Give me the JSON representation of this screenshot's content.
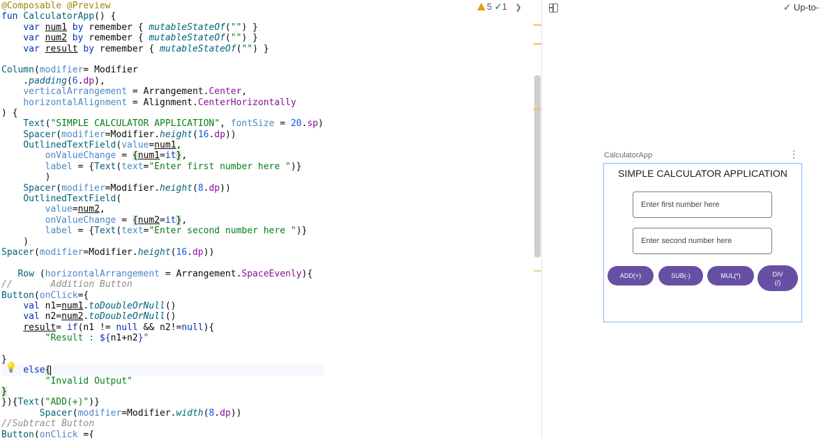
{
  "editor": {
    "inspections": {
      "warnings": "5",
      "weak_warnings": "1"
    },
    "code_lines": [
      [
        [
          "ann",
          "@Composable @Preview"
        ]
      ],
      [
        [
          "kw",
          "fun "
        ],
        [
          "fn",
          "CalculatorApp"
        ],
        [
          "",
          "() {"
        ]
      ],
      [
        [
          "",
          "    "
        ],
        [
          "kw",
          "var "
        ],
        [
          "uv",
          "num1"
        ],
        [
          "kw",
          " by "
        ],
        [
          "",
          "remember { "
        ],
        [
          "ext",
          "mutableStateOf"
        ],
        [
          "",
          "("
        ],
        [
          "str",
          "\"\""
        ],
        [
          "",
          ") }"
        ]
      ],
      [
        [
          "",
          "    "
        ],
        [
          "kw",
          "var "
        ],
        [
          "uv",
          "num2"
        ],
        [
          "kw",
          " by "
        ],
        [
          "",
          "remember { "
        ],
        [
          "ext",
          "mutableStateOf"
        ],
        [
          "",
          "("
        ],
        [
          "str",
          "\"\""
        ],
        [
          "",
          ") }"
        ]
      ],
      [
        [
          "",
          "    "
        ],
        [
          "kw",
          "var "
        ],
        [
          "uv",
          "result"
        ],
        [
          "kw",
          " by "
        ],
        [
          "",
          "remember { "
        ],
        [
          "ext",
          "mutableStateOf"
        ],
        [
          "",
          "("
        ],
        [
          "str",
          "\"\""
        ],
        [
          "",
          ") }"
        ]
      ],
      [],
      [
        [
          "fn",
          "Column"
        ],
        [
          "",
          "("
        ],
        [
          "param",
          "modifier"
        ],
        [
          "",
          "= Modifier"
        ]
      ],
      [
        [
          "",
          "    ."
        ],
        [
          "ext",
          "padding"
        ],
        [
          "",
          "("
        ],
        [
          "num",
          "6"
        ],
        [
          "",
          "."
        ],
        [
          "prop",
          "dp"
        ],
        [
          "",
          "),"
        ]
      ],
      [
        [
          "",
          "    "
        ],
        [
          "param",
          "verticalArrangement"
        ],
        [
          "",
          " = Arrangement."
        ],
        [
          "prop",
          "Center"
        ],
        [
          "",
          ","
        ]
      ],
      [
        [
          "",
          "    "
        ],
        [
          "param",
          "horizontalAlignment"
        ],
        [
          "",
          " = Alignment."
        ],
        [
          "prop",
          "CenterHorizontally"
        ]
      ],
      [
        [
          "",
          ") {"
        ]
      ],
      [
        [
          "",
          "    "
        ],
        [
          "fn",
          "Text"
        ],
        [
          "",
          "("
        ],
        [
          "str",
          "\"SIMPLE CALCULATOR APPLICATION\""
        ],
        [
          "",
          ", "
        ],
        [
          "param",
          "fontSize"
        ],
        [
          "",
          " = "
        ],
        [
          "num",
          "20"
        ],
        [
          "",
          "."
        ],
        [
          "prop",
          "sp"
        ],
        [
          "",
          ")"
        ]
      ],
      [
        [
          "",
          "    "
        ],
        [
          "fn",
          "Spacer"
        ],
        [
          "",
          "("
        ],
        [
          "param",
          "modifier"
        ],
        [
          "",
          "=Modifier."
        ],
        [
          "ext",
          "height"
        ],
        [
          "",
          "("
        ],
        [
          "num",
          "16"
        ],
        [
          "",
          "."
        ],
        [
          "prop",
          "dp"
        ],
        [
          "",
          "))"
        ]
      ],
      [
        [
          "",
          "    "
        ],
        [
          "fn",
          "OutlinedTextField"
        ],
        [
          "",
          "("
        ],
        [
          "param",
          "value"
        ],
        [
          "",
          "="
        ],
        [
          "uv",
          "num1"
        ],
        [
          "",
          ","
        ]
      ],
      [
        [
          "",
          "        "
        ],
        [
          "param",
          "onValueChange"
        ],
        [
          "",
          " = "
        ],
        [
          "hl",
          "{"
        ],
        [
          "uv",
          "num1"
        ],
        [
          "",
          "="
        ],
        [
          "kw",
          "it"
        ],
        [
          "hl",
          "}"
        ],
        [
          "",
          ","
        ]
      ],
      [
        [
          "",
          "        "
        ],
        [
          "param",
          "label"
        ],
        [
          "",
          " = {"
        ],
        [
          "fn",
          "Text"
        ],
        [
          "",
          "("
        ],
        [
          "param",
          "text"
        ],
        [
          "",
          "="
        ],
        [
          "str",
          "\"Enter first number here \""
        ],
        [
          "",
          ")}"
        ]
      ],
      [
        [
          "",
          "        )"
        ]
      ],
      [
        [
          "",
          "    "
        ],
        [
          "fn",
          "Spacer"
        ],
        [
          "",
          "("
        ],
        [
          "param",
          "modifier"
        ],
        [
          "",
          "=Modifier."
        ],
        [
          "ext",
          "height"
        ],
        [
          "",
          "("
        ],
        [
          "num",
          "8"
        ],
        [
          "",
          "."
        ],
        [
          "prop",
          "dp"
        ],
        [
          "",
          "))"
        ]
      ],
      [
        [
          "",
          "    "
        ],
        [
          "fn",
          "OutlinedTextField"
        ],
        [
          "",
          "("
        ]
      ],
      [
        [
          "",
          "        "
        ],
        [
          "param",
          "value"
        ],
        [
          "",
          "="
        ],
        [
          "uv",
          "num2"
        ],
        [
          "",
          ","
        ]
      ],
      [
        [
          "",
          "        "
        ],
        [
          "param",
          "onValueChange"
        ],
        [
          "",
          " = "
        ],
        [
          "hl",
          "{"
        ],
        [
          "uv",
          "num2"
        ],
        [
          "",
          "="
        ],
        [
          "kw",
          "it"
        ],
        [
          "hl",
          "}"
        ],
        [
          "",
          ","
        ]
      ],
      [
        [
          "",
          "        "
        ],
        [
          "param",
          "label"
        ],
        [
          "",
          " = {"
        ],
        [
          "fn",
          "Text"
        ],
        [
          "",
          "("
        ],
        [
          "param",
          "text"
        ],
        [
          "",
          "="
        ],
        [
          "str",
          "\"Enter second number here \""
        ],
        [
          "",
          ")}"
        ]
      ],
      [
        [
          "",
          "    )"
        ]
      ],
      [
        [
          "fn",
          "Spacer"
        ],
        [
          "",
          "("
        ],
        [
          "param",
          "modifier"
        ],
        [
          "",
          "=Modifier."
        ],
        [
          "ext",
          "height"
        ],
        [
          "",
          "("
        ],
        [
          "num",
          "16"
        ],
        [
          "",
          "."
        ],
        [
          "prop",
          "dp"
        ],
        [
          "",
          "))"
        ]
      ],
      [],
      [
        [
          "",
          "   "
        ],
        [
          "fn",
          "Row"
        ],
        [
          "",
          " ("
        ],
        [
          "param",
          "horizontalArrangement"
        ],
        [
          "",
          " = Arrangement."
        ],
        [
          "prop",
          "SpaceEvenly"
        ],
        [
          "",
          "){"
        ]
      ],
      [
        [
          "cmt",
          "//       Addition Button"
        ]
      ],
      [
        [
          "fn",
          "Button"
        ],
        [
          "",
          "("
        ],
        [
          "param",
          "onClick"
        ],
        [
          "",
          "={"
        ]
      ],
      [
        [
          "",
          "    "
        ],
        [
          "kw",
          "val "
        ],
        [
          "",
          "n1="
        ],
        [
          "uv",
          "num1"
        ],
        [
          "",
          "."
        ],
        [
          "ext",
          "toDoubleOrNull"
        ],
        [
          "",
          "()"
        ]
      ],
      [
        [
          "",
          "    "
        ],
        [
          "kw",
          "val "
        ],
        [
          "",
          "n2="
        ],
        [
          "uv",
          "num2"
        ],
        [
          "",
          "."
        ],
        [
          "ext",
          "toDoubleOrNull"
        ],
        [
          "",
          "()"
        ]
      ],
      [
        [
          "",
          "    "
        ],
        [
          "uv",
          "result"
        ],
        [
          "",
          "= "
        ],
        [
          "kw",
          "if"
        ],
        [
          "",
          "(n1 != "
        ],
        [
          "kw",
          "null"
        ],
        [
          "",
          " && n2!="
        ],
        [
          "kw",
          "null"
        ],
        [
          "",
          "){"
        ]
      ],
      [
        [
          "",
          "        "
        ],
        [
          "str",
          "\"Result : "
        ],
        [
          "tmpl",
          "${"
        ],
        [
          "",
          "n1+n2"
        ],
        [
          "tmpl",
          "}"
        ],
        [
          "str",
          "\""
        ]
      ],
      [],
      [
        [
          "",
          "}"
        ]
      ],
      [
        [
          "",
          "    "
        ],
        [
          "kw",
          "else"
        ],
        [
          "hl",
          "{"
        ],
        [
          "caret",
          ""
        ]
      ],
      [
        [
          "",
          "        "
        ],
        [
          "str",
          "\"Invalid Output\""
        ]
      ],
      [
        [
          "hl",
          "}"
        ]
      ],
      [
        [
          "",
          "}){"
        ],
        [
          "fn",
          "Text"
        ],
        [
          "",
          "("
        ],
        [
          "str",
          "\"ADD(+)\""
        ],
        [
          "",
          ")}"
        ]
      ],
      [
        [
          "",
          "       "
        ],
        [
          "fn",
          "Spacer"
        ],
        [
          "",
          "("
        ],
        [
          "param",
          "modifier"
        ],
        [
          "",
          "=Modifier."
        ],
        [
          "ext",
          "width"
        ],
        [
          "",
          "("
        ],
        [
          "num",
          "8"
        ],
        [
          "",
          "."
        ],
        [
          "prop",
          "dp"
        ],
        [
          "",
          "))"
        ]
      ],
      [
        [
          "cmt",
          "//Subtract Button"
        ]
      ],
      [
        [
          "fn",
          "Button"
        ],
        [
          "",
          "("
        ],
        [
          "param",
          "onClick"
        ],
        [
          "",
          " ={"
        ]
      ]
    ]
  },
  "preview": {
    "status": "Up-to-",
    "composable_name": "CalculatorApp",
    "more_icon": "⋮",
    "app": {
      "title": "SIMPLE CALCULATOR APPLICATION",
      "field1_label": "Enter first number here",
      "field2_label": "Enter second number here",
      "buttons": {
        "add": "ADD(+)",
        "sub": "SUB(-)",
        "mul": "MUL(*)",
        "div_line1": "DIV",
        "div_line2": "(/)"
      },
      "colors": {
        "button": "#6750a4",
        "device_border": "#8ab4f8"
      }
    }
  }
}
